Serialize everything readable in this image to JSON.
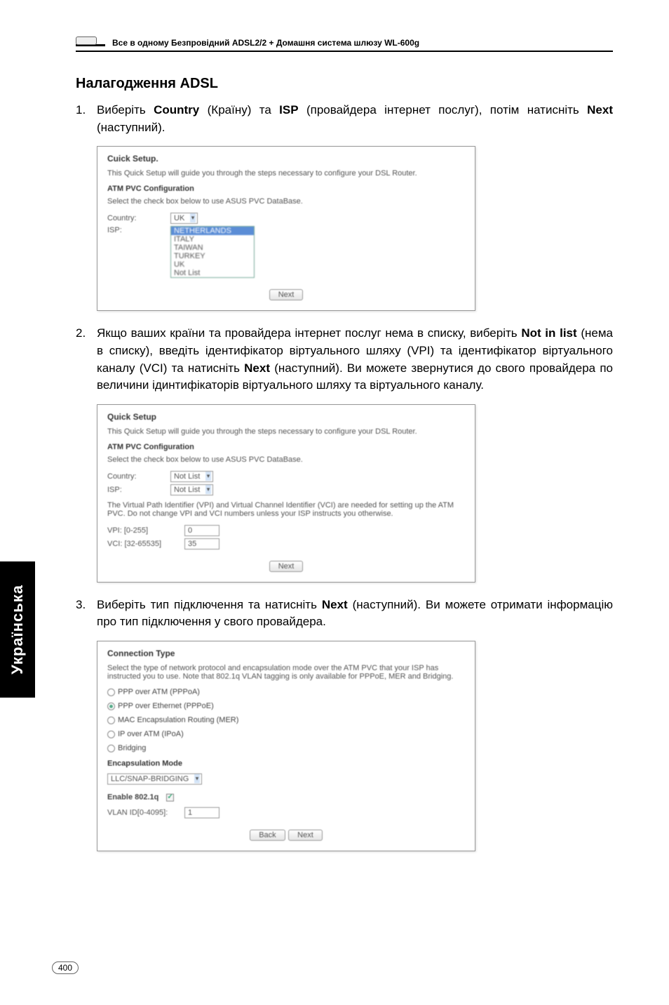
{
  "header": {
    "text": "Все в одному Безпровідний ADSL2/2 + Домашня система шлюзу WL-600g"
  },
  "section_title": "Налагодження ADSL",
  "items": [
    {
      "num": "1.",
      "parts": [
        "Виберіть ",
        "Country",
        " (Країну) та ",
        "ISP",
        " (провайдера інтернет послуг), потім натисніть ",
        "Next",
        " (наступний)."
      ]
    },
    {
      "num": "2.",
      "parts": [
        "Якщо ваших країни та провайдера інтернет послуг нема в списку, виберіть ",
        "Not in list",
        " (нема в списку), введіть ідентифікатор віртуального шляху (VPI) та ідентифікатор віртуального каналу (VCI) та натисніть ",
        "Next",
        " (наступний). Ви можете звернутися до свого провайдера по величини ідинтифікаторів віртуального шляху та віртуального каналу."
      ]
    },
    {
      "num": "3.",
      "parts": [
        "Виберіть тип підключення та натисніть ",
        "Next",
        " (наступний). Ви можете отримати інформацію про тип підключення у свого провайдера."
      ]
    }
  ],
  "scr1": {
    "title": "Cuick Setup.",
    "desc": "This Quick Setup will guide you through the steps necessary to configure your DSL Router.",
    "subhead": "ATM PVC Configuration",
    "select_text": "Select the check box below to use ASUS PVC DataBase.",
    "country_label": "Country:",
    "country_value": "UK",
    "isp_label": "ISP:",
    "isp_options": [
      "NETHERLANDS",
      "ITALY",
      "TAIWAN",
      "TURKEY",
      "UK",
      "Not List"
    ],
    "btn": "Next"
  },
  "scr2": {
    "title": "Quick Setup",
    "desc": "This Quick Setup will guide you through the steps necessary to configure your DSL Router.",
    "subhead": "ATM PVC Configuration",
    "select_text": "Select the check box below to use ASUS PVC DataBase.",
    "country_label": "Country:",
    "country_value": "Not List",
    "isp_label": "ISP:",
    "isp_value": "Not List",
    "vpi_text": "The Virtual Path Identifier (VPI) and Virtual Channel Identifier (VCI) are needed for setting up the ATM PVC. Do not change VPI and VCI numbers unless your ISP instructs you otherwise.",
    "vpi_label": "VPI: [0-255]",
    "vpi_value": "0",
    "vci_label": "VCI: [32-65535]",
    "vci_value": "35",
    "btn": "Next"
  },
  "scr3": {
    "title": "Connection Type",
    "desc": "Select the type of network protocol and encapsulation mode over the ATM PVC that your ISP has instructed you to use. Note that 802.1q VLAN tagging is only available for PPPoE, MER and Bridging.",
    "opts": [
      "PPP over ATM (PPPoA)",
      "PPP over Ethernet (PPPoE)",
      "MAC Encapsulation Routing (MER)",
      "IP over ATM (IPoA)",
      "Bridging"
    ],
    "encap_label": "Encapsulation Mode",
    "encap_value": "LLC/SNAP-BRIDGING",
    "enable_label": "Enable 802.1q",
    "vlan_label": "VLAN ID[0-4095]:",
    "vlan_value": "1",
    "btn_back": "Back",
    "btn_next": "Next"
  },
  "side_tab": "Українська",
  "page_num": "400"
}
